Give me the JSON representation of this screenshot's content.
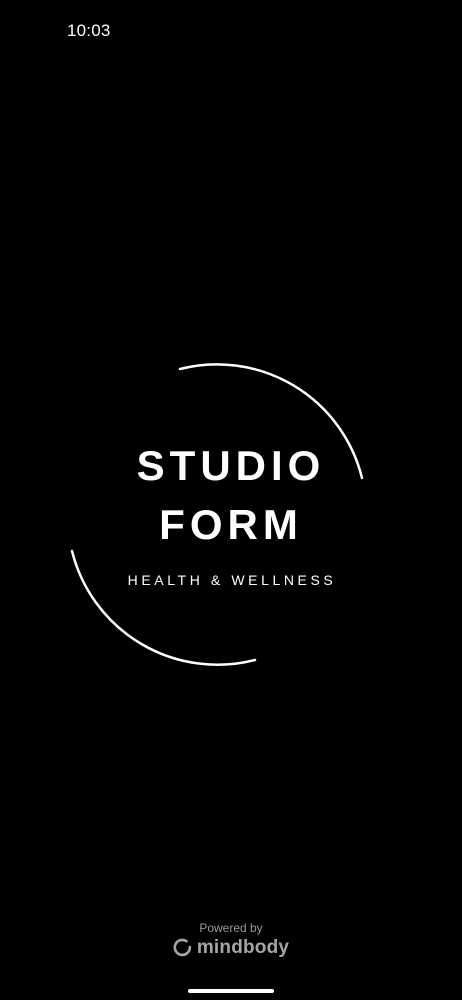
{
  "status_bar": {
    "time": "10:03"
  },
  "logo": {
    "line1": "STUDIO",
    "line2": "FORM",
    "tagline": "HEALTH & WELLNESS"
  },
  "footer": {
    "powered_by": "Powered by",
    "brand": "mindbody",
    "brand_icon": "mindbody-logo-icon"
  },
  "colors": {
    "background": "#000000",
    "logo": "#ffffff",
    "footer_text": "#9a9a9a"
  }
}
